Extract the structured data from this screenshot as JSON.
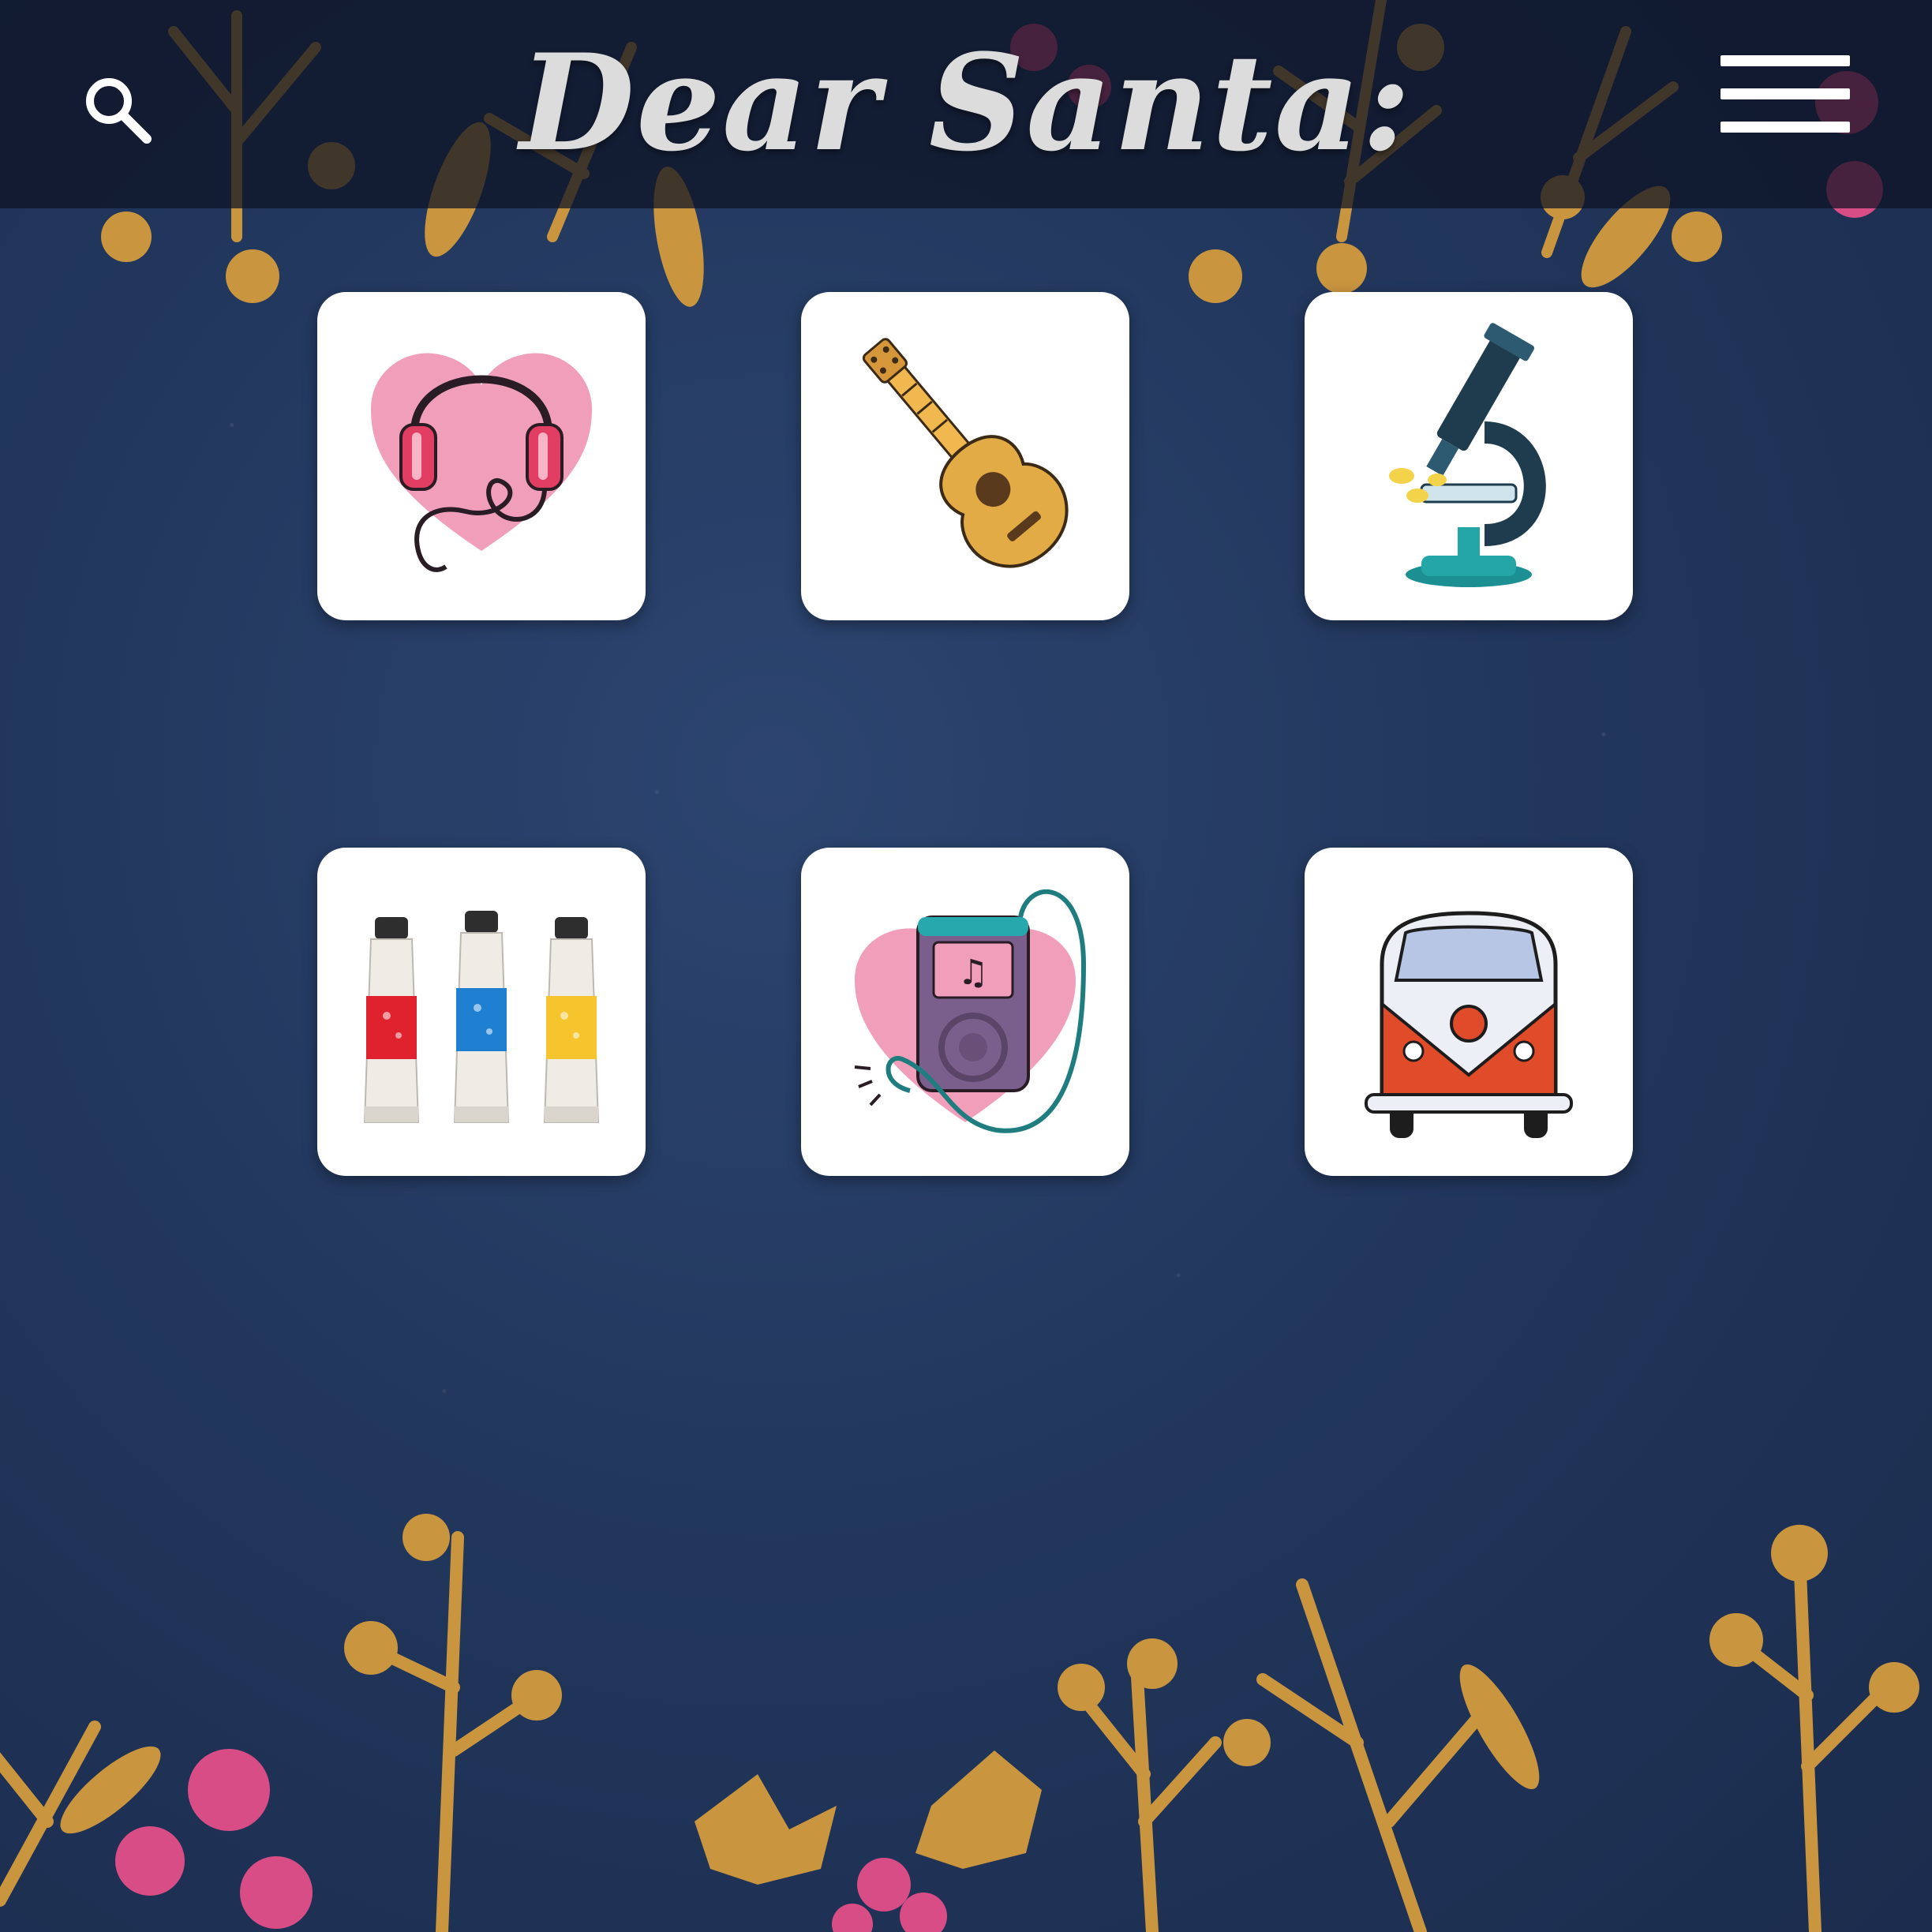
{
  "header": {
    "title": "Dear Santa:",
    "search_icon": "search-icon",
    "menu_icon": "hamburger-menu-icon"
  },
  "gifts": [
    {
      "icon": "heart-headphones-icon"
    },
    {
      "icon": "guitar-icon"
    },
    {
      "icon": "microscope-icon"
    },
    {
      "icon": "paint-tubes-icon"
    },
    {
      "icon": "music-player-icon"
    },
    {
      "icon": "camper-van-icon"
    }
  ],
  "colors": {
    "background": "#22375d",
    "header_bar": "#0c1222",
    "title": "#dcdcdc",
    "gold": "#c9953f",
    "berry": "#d94d86",
    "tile": "#ffffff"
  }
}
